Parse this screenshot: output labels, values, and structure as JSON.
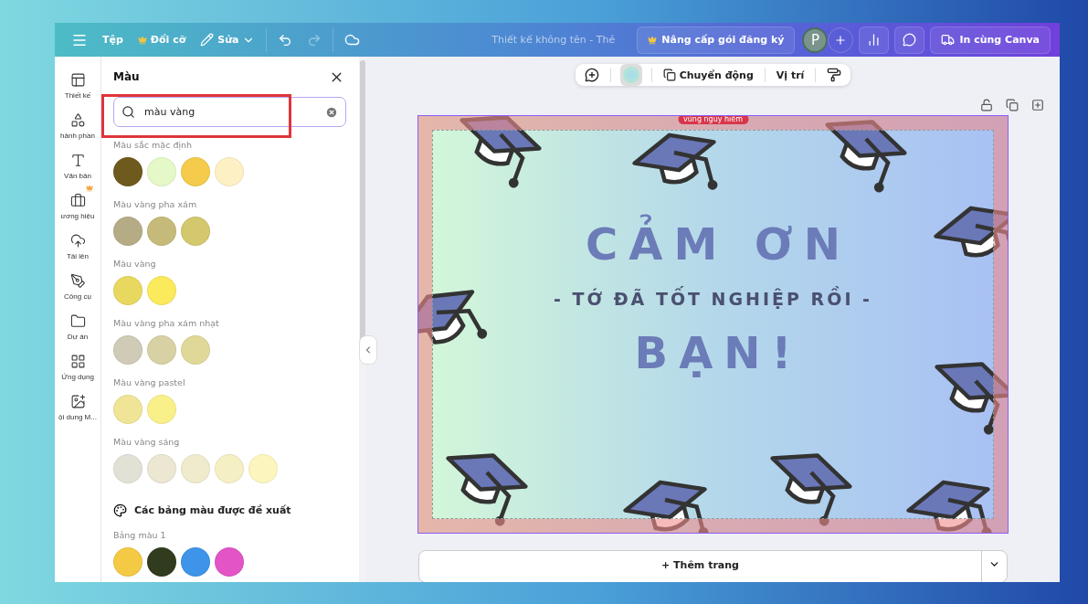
{
  "topbar": {
    "menu": [
      {
        "label": "Tệp",
        "kind": "plain"
      },
      {
        "label": "Đổi cỡ",
        "kind": "premium"
      },
      {
        "label": "Sửa",
        "kind": "edit"
      }
    ],
    "title": "Thiết kế không tên - Thẻ",
    "upgrade": "Nâng cấp gói đăng ký",
    "avatar": "P",
    "print": "In cùng Canva"
  },
  "rail": [
    {
      "label": "Thiết kế",
      "kind": "design",
      "premium": false
    },
    {
      "label": "hành phần",
      "kind": "elements",
      "premium": false
    },
    {
      "label": "Văn bản",
      "kind": "text",
      "premium": false
    },
    {
      "label": "ương hiệu",
      "kind": "brand",
      "premium": true
    },
    {
      "label": "Tải lên",
      "kind": "upload",
      "premium": false
    },
    {
      "label": "Công cụ",
      "kind": "tools",
      "premium": false
    },
    {
      "label": "Dự án",
      "kind": "projects",
      "premium": false
    },
    {
      "label": "Ứng dụng",
      "kind": "apps",
      "premium": false
    },
    {
      "label": "ội dung M...",
      "kind": "media",
      "premium": false
    }
  ],
  "panel": {
    "title": "Màu",
    "search": {
      "value": "màu vàng"
    },
    "groups": [
      {
        "name": "Màu sắc mặc định",
        "swatches": [
          {
            "color": "#6e5a1c"
          },
          {
            "color": "#e4f8c8"
          },
          {
            "color": "#f4cb4a"
          },
          {
            "color": "#fdf0c4"
          }
        ]
      },
      {
        "name": "Màu vàng pha xám",
        "swatches": [
          {
            "color": "#b5ac86"
          },
          {
            "color": "#c6ba7a"
          },
          {
            "color": "#d4c86e"
          }
        ]
      },
      {
        "name": "Màu vàng",
        "swatches": [
          {
            "color": "#e8d860"
          },
          {
            "color": "#faea5c"
          }
        ]
      },
      {
        "name": "Màu vàng pha xám nhạt",
        "swatches": [
          {
            "color": "#cfcbb6"
          },
          {
            "color": "#d8d1a4"
          },
          {
            "color": "#e0d898"
          }
        ]
      },
      {
        "name": "Màu vàng pastel",
        "swatches": [
          {
            "color": "#f0e496"
          },
          {
            "color": "#faf08a"
          }
        ]
      },
      {
        "name": "Màu vàng sáng",
        "swatches": [
          {
            "color": "#e2e1d6"
          },
          {
            "color": "#ebe7d2"
          },
          {
            "color": "#f0ebcc"
          },
          {
            "color": "#f5efc4"
          },
          {
            "color": "#fcf6be"
          }
        ]
      }
    ],
    "suggested": "Các bảng màu được đề xuất",
    "palette": {
      "name": "Bảng màu 1",
      "swatches": [
        {
          "color": "#f4c944"
        },
        {
          "color": "#313b1e"
        },
        {
          "color": "#3d94e8"
        },
        {
          "color": "#e354c7"
        }
      ]
    }
  },
  "toolbar": {
    "animate": "Chuyển động",
    "position": "Vị trí"
  },
  "design": {
    "danger": "vùng nguy hiểm",
    "line1": "CẢM ƠN",
    "line2": "- TỚ ĐÃ TỐT NGHIỆP RỒI -",
    "line3": "BẠN!"
  },
  "add_page": "+ Thêm trang"
}
